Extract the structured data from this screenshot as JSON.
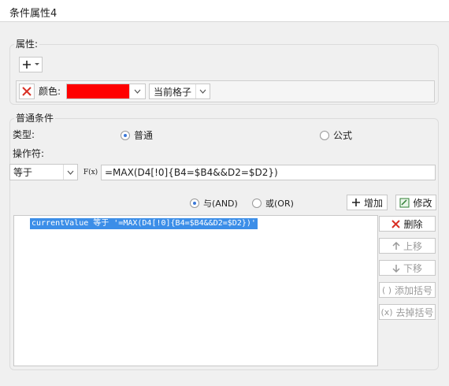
{
  "window": {
    "title": "条件属性4"
  },
  "attributes": {
    "section_label": "属性:",
    "add_icon": "plus-icon",
    "color_label": "颜色:",
    "color_value": "#ff0000",
    "scope_value": "当前格子"
  },
  "condition": {
    "section_label": "普通条件",
    "type_label": "类型:",
    "type_options": [
      {
        "label": "普通",
        "selected": true
      },
      {
        "label": "公式",
        "selected": false
      }
    ],
    "operator_label": "操作符:",
    "operator_value": "等于",
    "fx_label": "F(x)",
    "formula_value": "=MAX(D4[!0]{B4=$B4&&D2=$D2})",
    "logic_options": [
      {
        "label": "与(AND)",
        "selected": true
      },
      {
        "label": "或(OR)",
        "selected": false
      }
    ],
    "add_button": "增加",
    "edit_button": "修改",
    "list_items": [
      "currentValue 等于 '=MAX(D4[!0]{B4=$B4&&D2=$D2})'"
    ],
    "side_buttons": [
      "删除",
      "上移",
      "下移",
      "添加括号",
      "去掉括号"
    ]
  }
}
